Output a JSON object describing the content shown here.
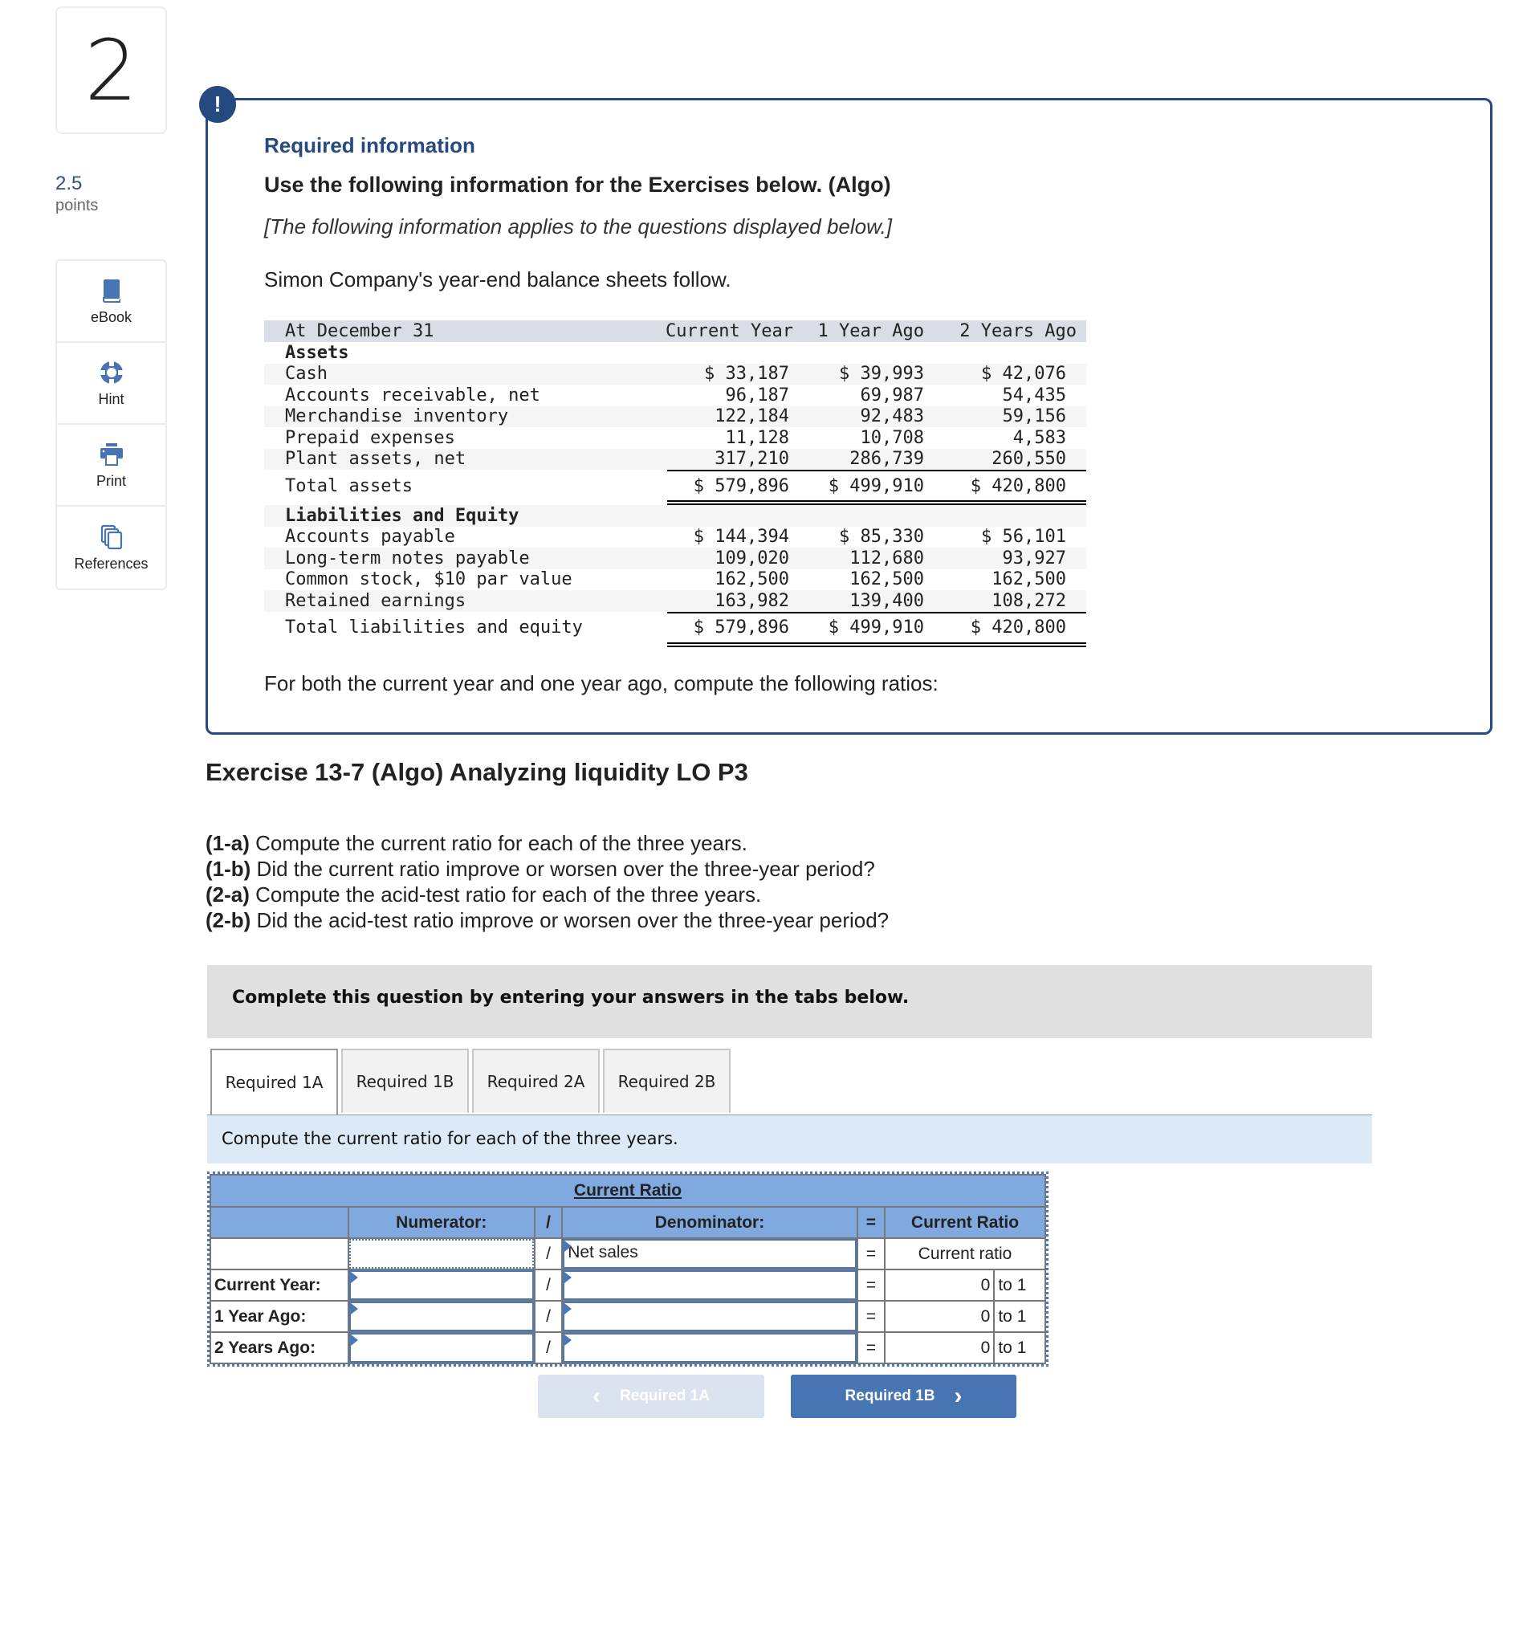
{
  "question": {
    "number": "2",
    "points_value": "2.5",
    "points_label": "points"
  },
  "tools": [
    {
      "label": "eBook",
      "icon": "book-icon"
    },
    {
      "label": "Hint",
      "icon": "lifebuoy-icon"
    },
    {
      "label": "Print",
      "icon": "printer-icon"
    },
    {
      "label": "References",
      "icon": "documents-icon"
    }
  ],
  "info": {
    "badge": "!",
    "heading": "Required information",
    "title": "Use the following information for the Exercises below. (Algo)",
    "applies": "[The following information applies to the questions displayed below.]",
    "intro": "Simon Company's year-end balance sheets follow.",
    "closing": "For both the current year and one year ago, compute the following ratios:"
  },
  "balance_sheet": {
    "header": {
      "label": "At December 31",
      "cols": [
        "Current Year",
        "1 Year Ago",
        "2 Years Ago"
      ]
    },
    "assets_heading": "Assets",
    "assets": [
      {
        "label": "Cash",
        "values": [
          "$ 33,187",
          "$ 39,993",
          "$ 42,076"
        ]
      },
      {
        "label": "Accounts receivable, net",
        "values": [
          "96,187",
          "69,987",
          "54,435"
        ]
      },
      {
        "label": "Merchandise inventory",
        "values": [
          "122,184",
          "92,483",
          "59,156"
        ]
      },
      {
        "label": "Prepaid expenses",
        "values": [
          "11,128",
          "10,708",
          "4,583"
        ]
      },
      {
        "label": "Plant assets, net",
        "values": [
          "317,210",
          "286,739",
          "260,550"
        ]
      }
    ],
    "total_assets": {
      "label": "Total assets",
      "values": [
        "$ 579,896",
        "$ 499,910",
        "$ 420,800"
      ]
    },
    "liab_heading": "Liabilities and Equity",
    "liabilities": [
      {
        "label": "Accounts payable",
        "values": [
          "$ 144,394",
          "$ 85,330",
          "$ 56,101"
        ]
      },
      {
        "label": "Long-term notes payable",
        "values": [
          "109,020",
          "112,680",
          "93,927"
        ]
      },
      {
        "label": "Common stock, $10 par value",
        "values": [
          "162,500",
          "162,500",
          "162,500"
        ]
      },
      {
        "label": "Retained earnings",
        "values": [
          "163,982",
          "139,400",
          "108,272"
        ]
      }
    ],
    "total_liab": {
      "label": "Total liabilities and equity",
      "values": [
        "$ 579,896",
        "$ 499,910",
        "$ 420,800"
      ]
    }
  },
  "exercise": {
    "title": "Exercise 13-7 (Algo) Analyzing liquidity LO P3",
    "requirements": [
      {
        "tag": "(1-a)",
        "text": " Compute the current ratio for each of the three years."
      },
      {
        "tag": "(1-b)",
        "text": " Did the current ratio improve or worsen over the three-year period?"
      },
      {
        "tag": "(2-a)",
        "text": " Compute the acid-test ratio for each of the three years."
      },
      {
        "tag": "(2-b)",
        "text": " Did the acid-test ratio improve or worsen over the three-year period?"
      }
    ],
    "complete_prompt": "Complete this question by entering your answers in the tabs below.",
    "tabs": [
      "Required 1A",
      "Required 1B",
      "Required 2A",
      "Required 2B"
    ],
    "active_tab": "Required 1A",
    "instruction": "Compute the current ratio for each of the three years."
  },
  "ratio_table": {
    "title": "Current Ratio",
    "headers": {
      "numerator": "Numerator:",
      "div": "/",
      "denominator": "Denominator:",
      "eq": "=",
      "result": "Current Ratio"
    },
    "formula_row": {
      "numerator": "",
      "div": "/",
      "denominator": "Net sales",
      "eq": "=",
      "result": "Current ratio"
    },
    "rows": [
      {
        "label": "Current Year:",
        "numerator": "",
        "div": "/",
        "denominator": "",
        "eq": "=",
        "result": "0",
        "unit": "to 1"
      },
      {
        "label": "1 Year Ago:",
        "numerator": "",
        "div": "/",
        "denominator": "",
        "eq": "=",
        "result": "0",
        "unit": "to 1"
      },
      {
        "label": "2 Years Ago:",
        "numerator": "",
        "div": "/",
        "denominator": "",
        "eq": "=",
        "result": "0",
        "unit": "to 1"
      }
    ]
  },
  "nav": {
    "prev_label": "Required 1A",
    "next_label": "Required 1B",
    "prev_icon": "‹",
    "next_icon": "›"
  },
  "colors": {
    "brand_navy": "#254a7f",
    "table_header_blue": "#80aadf",
    "instruction_bg": "#dceaf7",
    "next_button": "#4774b2",
    "prev_button_disabled": "#dae3ef"
  }
}
